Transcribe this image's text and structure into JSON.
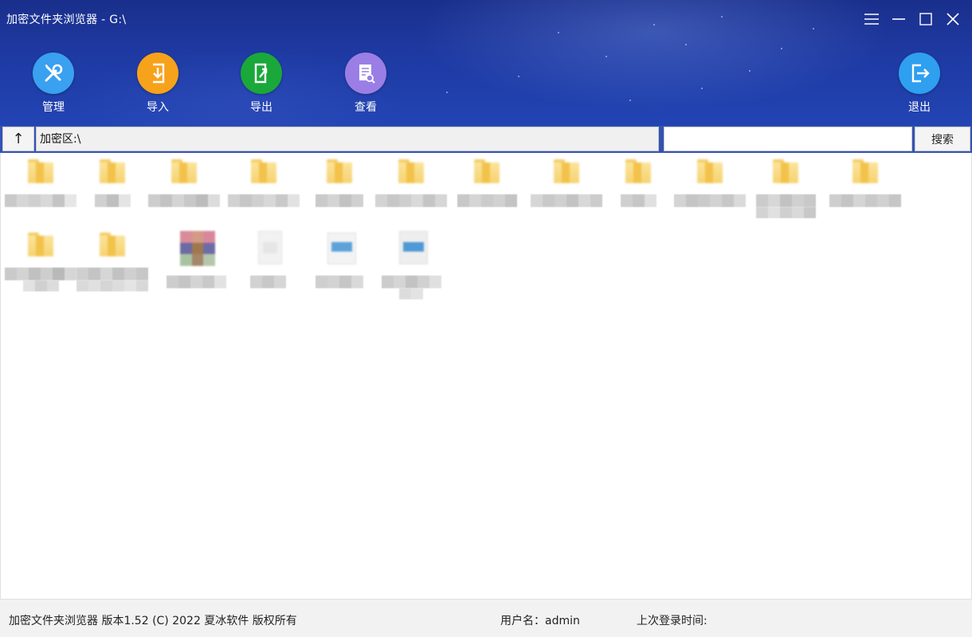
{
  "window": {
    "title": "加密文件夹浏览器  - G:\\"
  },
  "toolbar": {
    "manage_label": "管理",
    "import_label": "导入",
    "export_label": "导出",
    "view_label": "查看",
    "exit_label": "退出"
  },
  "addressbar": {
    "up_label": "↑",
    "path": "加密区:\\",
    "search_value": "",
    "search_button": "搜索"
  },
  "statusbar": {
    "app_info": "加密文件夹浏览器 版本1.52 (C) 2022 夏冰软件 版权所有",
    "username_label": "用户名：admin",
    "last_login_label": "上次登录时间:"
  },
  "colors": {
    "header_bg": "#1e3aa3",
    "manage_icon": "#3aa0f0",
    "import_icon": "#f7a21b",
    "export_icon": "#1aa83a",
    "view_icon": "#9a7ee6",
    "exit_icon": "#2f9ff0",
    "folder_yellow": "#f6d371"
  },
  "icons": {
    "manage": "wrench-screwdriver-icon",
    "import": "import-arrow-icon",
    "export": "export-arrow-icon",
    "view": "document-magnifier-icon",
    "exit": "exit-arrow-icon",
    "menu": "hamburger-menu-icon",
    "minimize": "minimize-icon",
    "maximize": "maximize-icon",
    "close": "close-icon"
  }
}
